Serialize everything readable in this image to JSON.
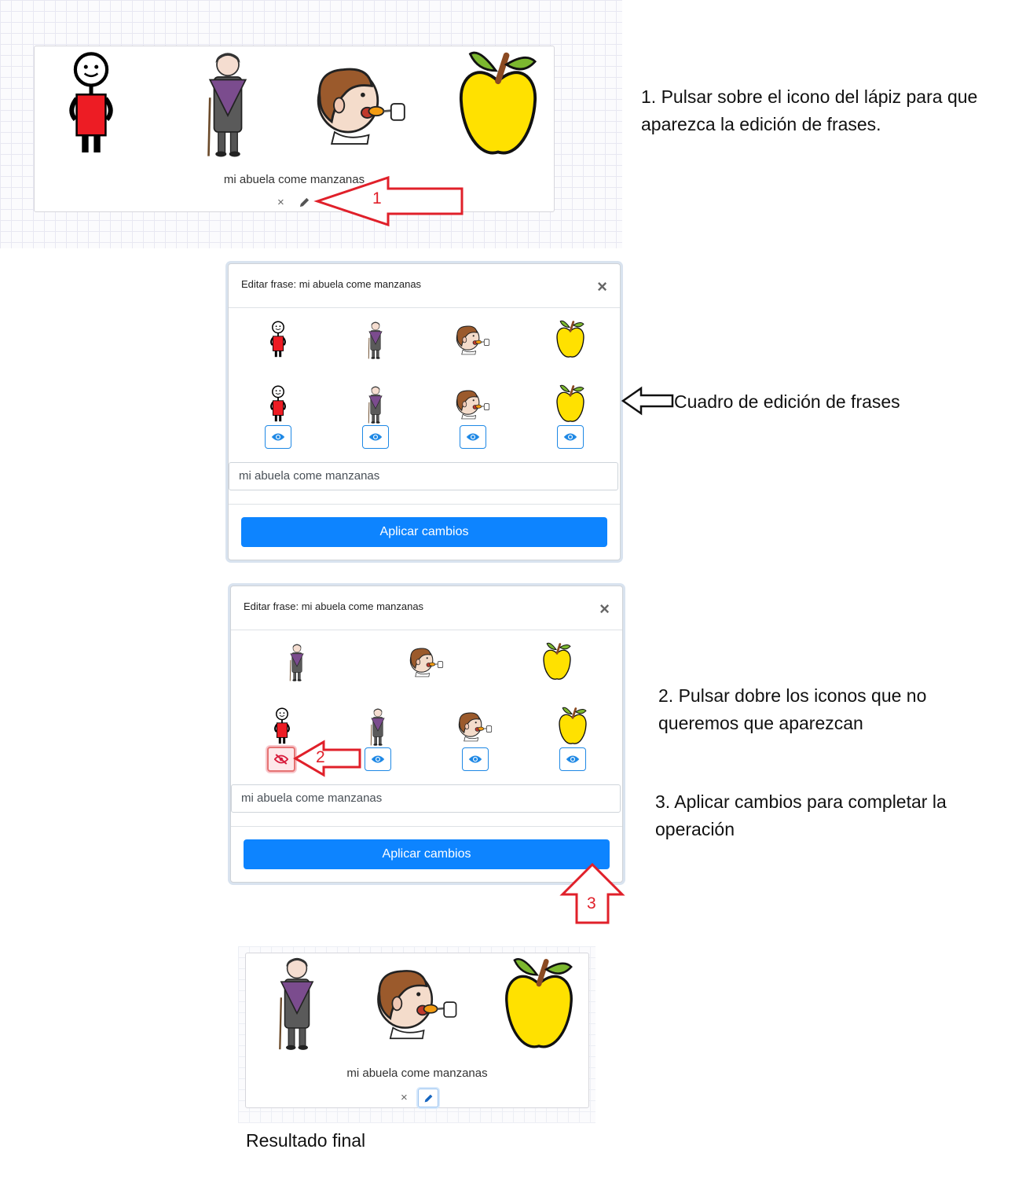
{
  "step1": {
    "phrase": "mi abuela come manzanas",
    "delete_icon": "×",
    "edit_icon": "pencil-icon",
    "arrow_number": "1",
    "note": "1. Pulsar sobre el icono del lápiz para que aparezca la edición de frases."
  },
  "modal1": {
    "title": "Editar frase: mi abuela come manzanas",
    "close": "×",
    "input_value": "mi abuela come manzanas",
    "apply_label": "Aplicar cambios",
    "note": "Cuadro de edición de frases"
  },
  "modal2": {
    "title": "Editar frase: mi abuela come manzanas",
    "close": "×",
    "input_value": "mi abuela come manzanas",
    "apply_label": "Aplicar cambios",
    "arrow2_number": "2",
    "arrow3_number": "3",
    "note2": "2. Pulsar dobre los iconos que no queremos que aparezcan",
    "note3": "3. Aplicar cambios para completar la operación"
  },
  "result": {
    "phrase": "mi abuela come manzanas",
    "delete_icon": "×",
    "label": "Resultado final"
  },
  "colors": {
    "accent": "#0d84ff",
    "arrow": "#e0202a",
    "eye": "#1e88e5"
  }
}
